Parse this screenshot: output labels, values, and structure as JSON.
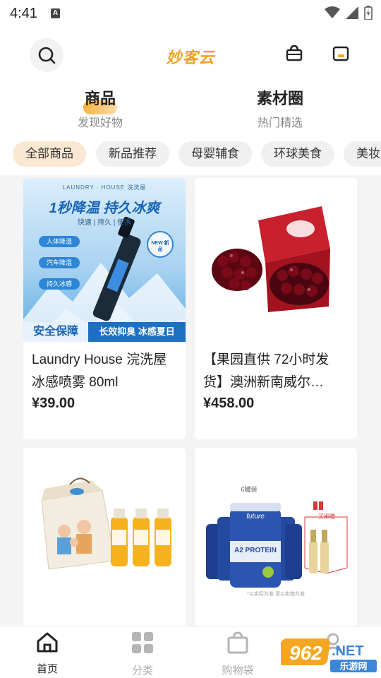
{
  "status": {
    "time": "4:41",
    "indicator": "A"
  },
  "header": {
    "brand": "妙客云"
  },
  "tabs": [
    {
      "title": "商品",
      "subtitle": "发现好物"
    },
    {
      "title": "素材圈",
      "subtitle": "热门精选"
    }
  ],
  "categories": [
    "全部商品",
    "新品推荐",
    "母婴辅食",
    "环球美食",
    "美妆"
  ],
  "products": [
    {
      "title": "Laundry House 浣洗屋 冰感喷雾 80ml",
      "price": "¥39.00",
      "image_text": {
        "brand": "LAUNDRY · HOUSE 浣洗屋",
        "headline": "1秒降温 持久冰爽",
        "sub": "快速 | 持久 | 便携",
        "pills": [
          "人体降温",
          "汽车降温",
          "持久冰感"
        ],
        "badge": "NEW 新品",
        "bottom_left": "安全保障",
        "bottom_right": "长效抑臭 冰感夏日"
      }
    },
    {
      "title": "【果园直供 72小时发货】澳洲新南威尔…",
      "price": "¥458.00"
    },
    {
      "title": "",
      "price": ""
    },
    {
      "title": "",
      "price": "",
      "image_text": {
        "tag": "6罐装",
        "can_brand": "future",
        "can_label": "A2 PROTEIN",
        "gift": "买即赠",
        "caption": "*以实际为准 请以实物为准"
      }
    }
  ],
  "nav": [
    {
      "label": "首页",
      "icon": "home-icon"
    },
    {
      "label": "分类",
      "icon": "grid-icon"
    },
    {
      "label": "购物袋",
      "icon": "bag-icon"
    },
    {
      "label": "",
      "icon": "profile-icon"
    }
  ],
  "watermark": {
    "text": "962.NET",
    "sub": "乐游网"
  },
  "colors": {
    "brand": "#f0a126",
    "active_chip": "#fbe8d2",
    "ice_blue": "#2d86d6"
  }
}
